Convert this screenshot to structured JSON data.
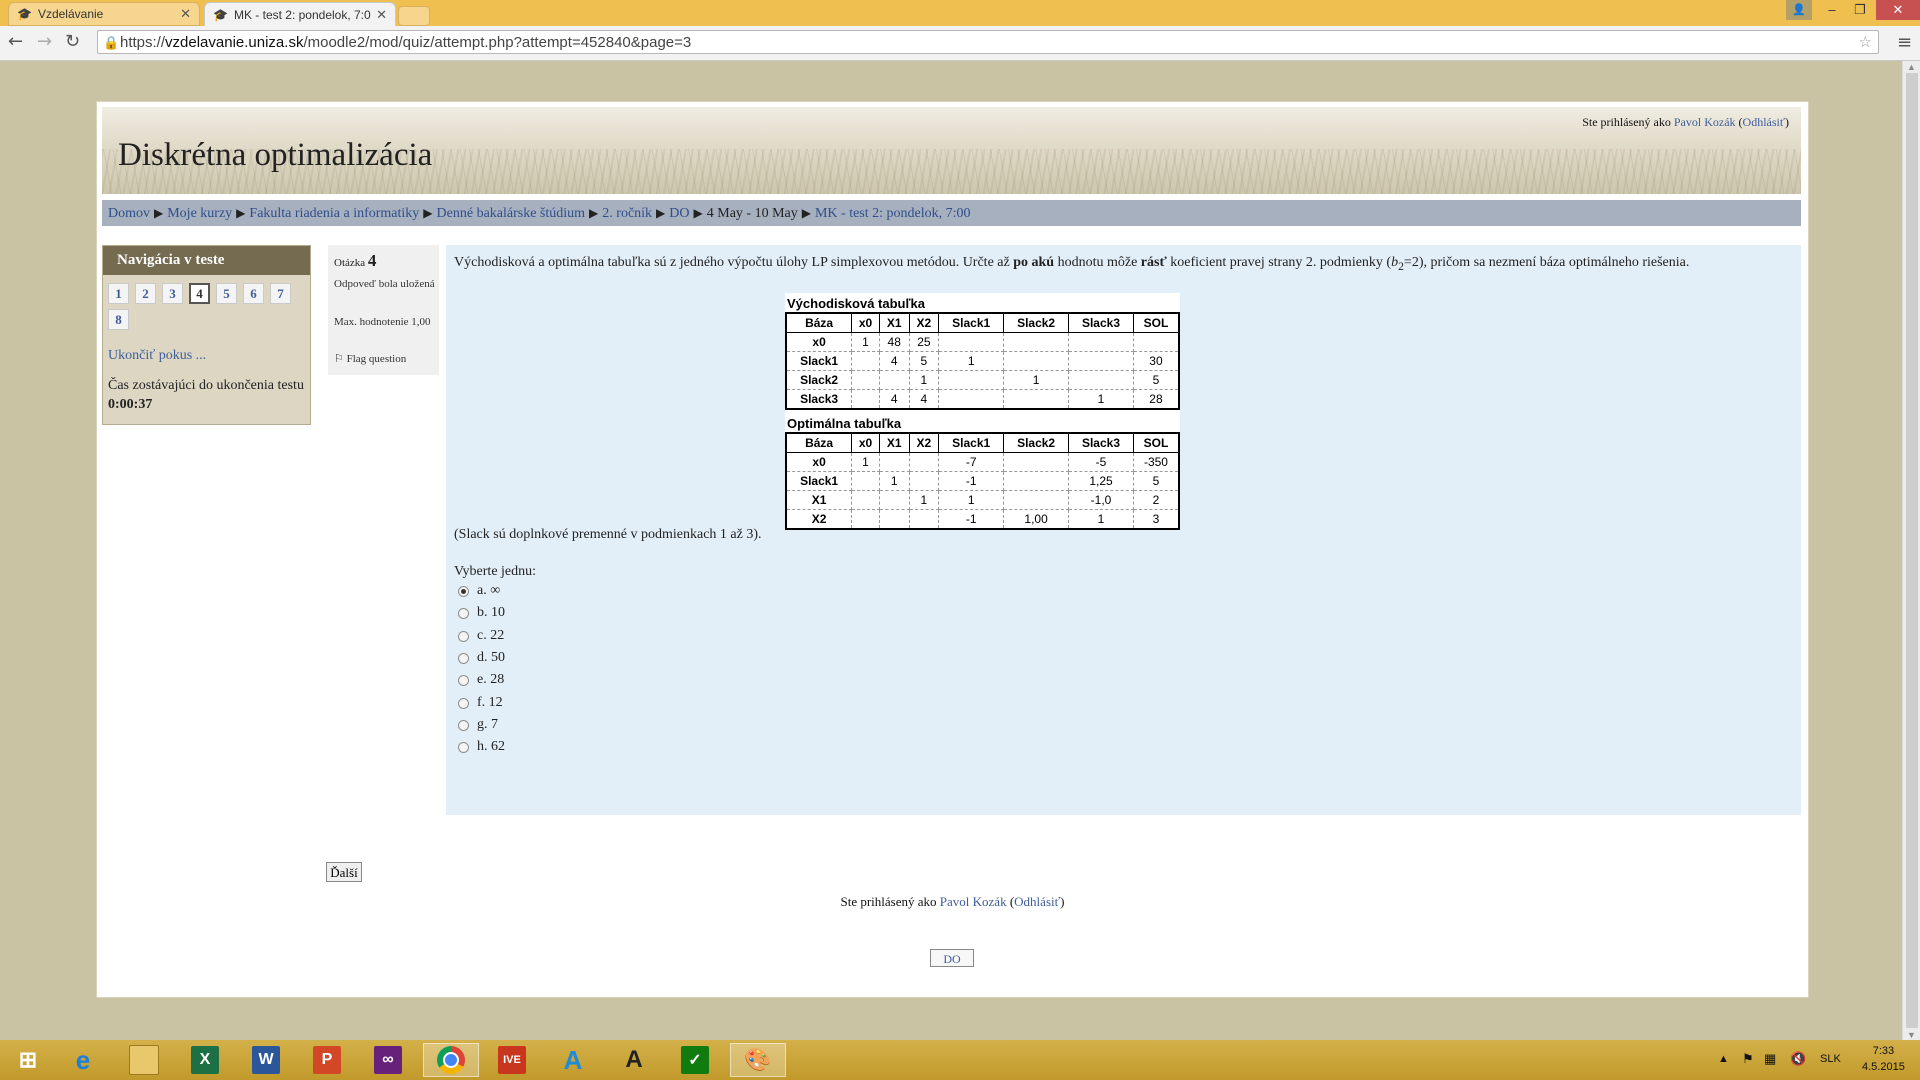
{
  "browser": {
    "tabs": [
      {
        "title": "Vzdelávanie",
        "active": false
      },
      {
        "title": "MK - test 2: pondelok, 7:0",
        "active": true
      }
    ],
    "url_prefix": "https://",
    "url_host": "vzdelavanie.uniza.sk",
    "url_path": "/moodle2/mod/quiz/attempt.php?attempt=452840&page=3"
  },
  "header": {
    "site_title": "Diskrétna optimalizácia",
    "login_prefix": "Ste prihlásený ako",
    "user_name": "Pavol Kozák",
    "logout": "Odhlásiť"
  },
  "breadcrumb": [
    {
      "label": "Domov",
      "link": true
    },
    {
      "label": "Moje kurzy",
      "link": true
    },
    {
      "label": "Fakulta riadenia a informatiky",
      "link": true
    },
    {
      "label": "Denné bakalárske štúdium",
      "link": true
    },
    {
      "label": "2. ročník",
      "link": true
    },
    {
      "label": "DO",
      "link": true
    },
    {
      "label": "4 May - 10 May",
      "link": false
    },
    {
      "label": "MK - test 2: pondelok, 7:00",
      "link": true
    }
  ],
  "quiz_nav": {
    "title": "Navigácia v teste",
    "questions": [
      "1",
      "2",
      "3",
      "4",
      "5",
      "6",
      "7",
      "8"
    ],
    "current": "4",
    "finish_label": "Ukončiť pokus ...",
    "time_label": "Čas zostávajúci do ukončenia testu",
    "time_value": "0:00:37"
  },
  "question_info": {
    "label": "Otázka",
    "number": "4",
    "state": "Odpoveď bola uložená",
    "grade": "Max. hodnotenie 1,00",
    "flag": "Flag question"
  },
  "question": {
    "text_1": "Východisková a optimálna tabuľka sú z jedného výpočtu úlohy LP simplexovou metódou. Určte až ",
    "bold_1": "po akú",
    "text_2": " hodnotu môže ",
    "bold_2": "rásť",
    "text_3": " koeficient pravej strany 2. podmienky (",
    "var": "b",
    "sub": "2",
    "text_4": "=2), pričom sa nezmení báza optimálneho riešenia.",
    "slack_note": "(Slack sú doplnkové premenné v podmienkach 1 až 3).",
    "choose_label": "Vyberte jednu:",
    "options": [
      "a. ∞",
      "b. 10",
      "c. 22",
      "d. 50",
      "e. 28",
      "f. 12",
      "g. 7",
      "h. 62"
    ],
    "selected": 0
  },
  "initial_table": {
    "caption": "Východisková tabuľka",
    "headers": [
      "Báza",
      "x0",
      "X1",
      "X2",
      "Slack1",
      "Slack2",
      "Slack3",
      "SOL"
    ],
    "rows": [
      [
        "x0",
        "1",
        "48",
        "25",
        "",
        "",
        "",
        ""
      ],
      [
        "Slack1",
        "",
        "4",
        "5",
        "1",
        "",
        "",
        "30"
      ],
      [
        "Slack2",
        "",
        "",
        "1",
        "",
        "1",
        "",
        "5"
      ],
      [
        "Slack3",
        "",
        "4",
        "4",
        "",
        "",
        "1",
        "28"
      ]
    ]
  },
  "optimal_table": {
    "caption": "Optimálna tabuľka",
    "headers": [
      "Báza",
      "x0",
      "X1",
      "X2",
      "Slack1",
      "Slack2",
      "Slack3",
      "SOL"
    ],
    "rows": [
      [
        "x0",
        "1",
        "",
        "",
        "-7",
        "",
        "-5",
        "-350"
      ],
      [
        "Slack1",
        "",
        "1",
        "",
        "-1",
        "",
        "1,25",
        "5"
      ],
      [
        "X1",
        "",
        "",
        "1",
        "1",
        "",
        "-1,0",
        "2"
      ],
      [
        "X2",
        "",
        "",
        "",
        "-1",
        "1,00",
        "1",
        "3"
      ]
    ]
  },
  "buttons": {
    "next": "Ďalší",
    "course": "DO"
  },
  "footer": {
    "prefix": "Ste prihlásený ako",
    "user_name": "Pavol Kozák",
    "logout": "Odhlásiť"
  },
  "taskbar": {
    "language": "SLK",
    "time": "7:33",
    "date": "4.5.2015",
    "apps": [
      "start-icon",
      "internet-explorer-icon",
      "file-explorer-icon",
      "excel-icon",
      "word-icon",
      "powerpoint-icon",
      "visual-studio-icon",
      "chrome-icon",
      "ive-icon",
      "azure-icon",
      "autocad-icon",
      "project-icon",
      "paint-icon"
    ]
  },
  "colors": {
    "titlebar": "#efc04f",
    "link": "#3e5d9b",
    "content_bg": "#e3eff8",
    "breadcrumb_bg": "#a7b0bf",
    "nav_header": "#746b51"
  }
}
